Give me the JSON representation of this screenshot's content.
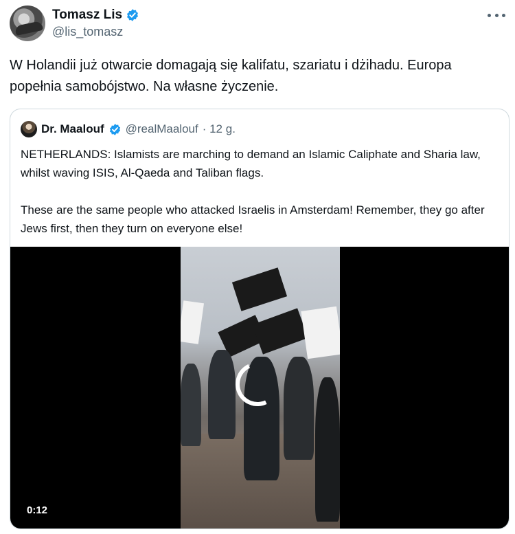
{
  "tweet": {
    "author": {
      "display_name": "Tomasz Lis",
      "handle": "@lis_tomasz",
      "verified": true
    },
    "text": "W Holandii już otwarcie domagają się kalifatu, szariatu i dżihadu. Europa popełnia samobójstwo. Na własne życzenie.",
    "more_icon": "more-horizontal-icon"
  },
  "quote": {
    "author": {
      "display_name": "Dr. Maalouf",
      "handle": "@realMaalouf",
      "time": "· 12 g.",
      "verified": true
    },
    "paragraphs": [
      "NETHERLANDS: Islamists are marching to demand an Islamic Caliphate and Sharia law, whilst waving ISIS, Al-Qaeda and Taliban flags.",
      "These are the same people who attacked Israelis in Amsterdam! Remember, they go after Jews first, then they turn on everyone else!"
    ],
    "video": {
      "duration": "0:12"
    }
  },
  "colors": {
    "verified_blue": "#1d9bf0",
    "secondary_text": "#536471",
    "border": "#cfd9de"
  }
}
